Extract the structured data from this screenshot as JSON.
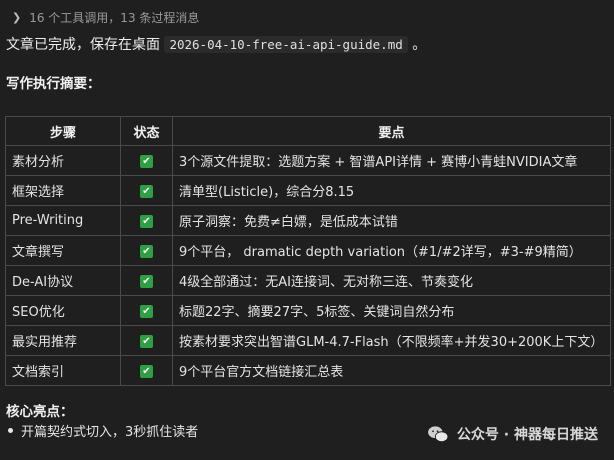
{
  "summary": {
    "text": "16 个工具调用，13 条过程消息"
  },
  "status_line": {
    "prefix": "文章已完成，保存在桌面",
    "filename": "2026-04-10-free-ai-api-guide.md",
    "suffix": "。"
  },
  "section_exec": {
    "title": "写作执行摘要："
  },
  "table": {
    "headers": [
      "步骤",
      "状态",
      "要点"
    ],
    "rows": [
      {
        "step": "素材分析",
        "status": "✔",
        "point": "3个源文件提取：选题方案 + 智谱API详情 + 赛博小青蛙NVIDIA文章"
      },
      {
        "step": "框架选择",
        "status": "✔",
        "point": "清单型(Listicle)，综合分8.15"
      },
      {
        "step": "Pre-Writing",
        "status": "✔",
        "point": "原子洞察：免费≠白嫖，是低成本试错"
      },
      {
        "step": "文章撰写",
        "status": "✔",
        "point": "9个平台， dramatic depth variation（#1/#2详写，#3-#9精简）"
      },
      {
        "step": "De-AI协议",
        "status": "✔",
        "point": "4级全部通过：无AI连接词、无对称三连、节奏变化"
      },
      {
        "step": "SEO优化",
        "status": "✔",
        "point": "标题22字、摘要27字、5标签、关键词自然分布"
      },
      {
        "step": "最实用推荐",
        "status": "✔",
        "point": "按素材要求突出智谱GLM-4.7-Flash（不限频率+并发30+200K上下文）"
      },
      {
        "step": "文档索引",
        "status": "✔",
        "point": "9个平台官方文档链接汇总表"
      }
    ]
  },
  "section_highlights": {
    "title": "核心亮点：",
    "bullets": [
      "开篇契约式切入，3秒抓住读者"
    ]
  },
  "watermark": {
    "text": "公众号 · 神器每日推送"
  },
  "colors": {
    "background": "#1f1f1f",
    "check_green": "#2ea043",
    "border": "#4a4a4a"
  }
}
